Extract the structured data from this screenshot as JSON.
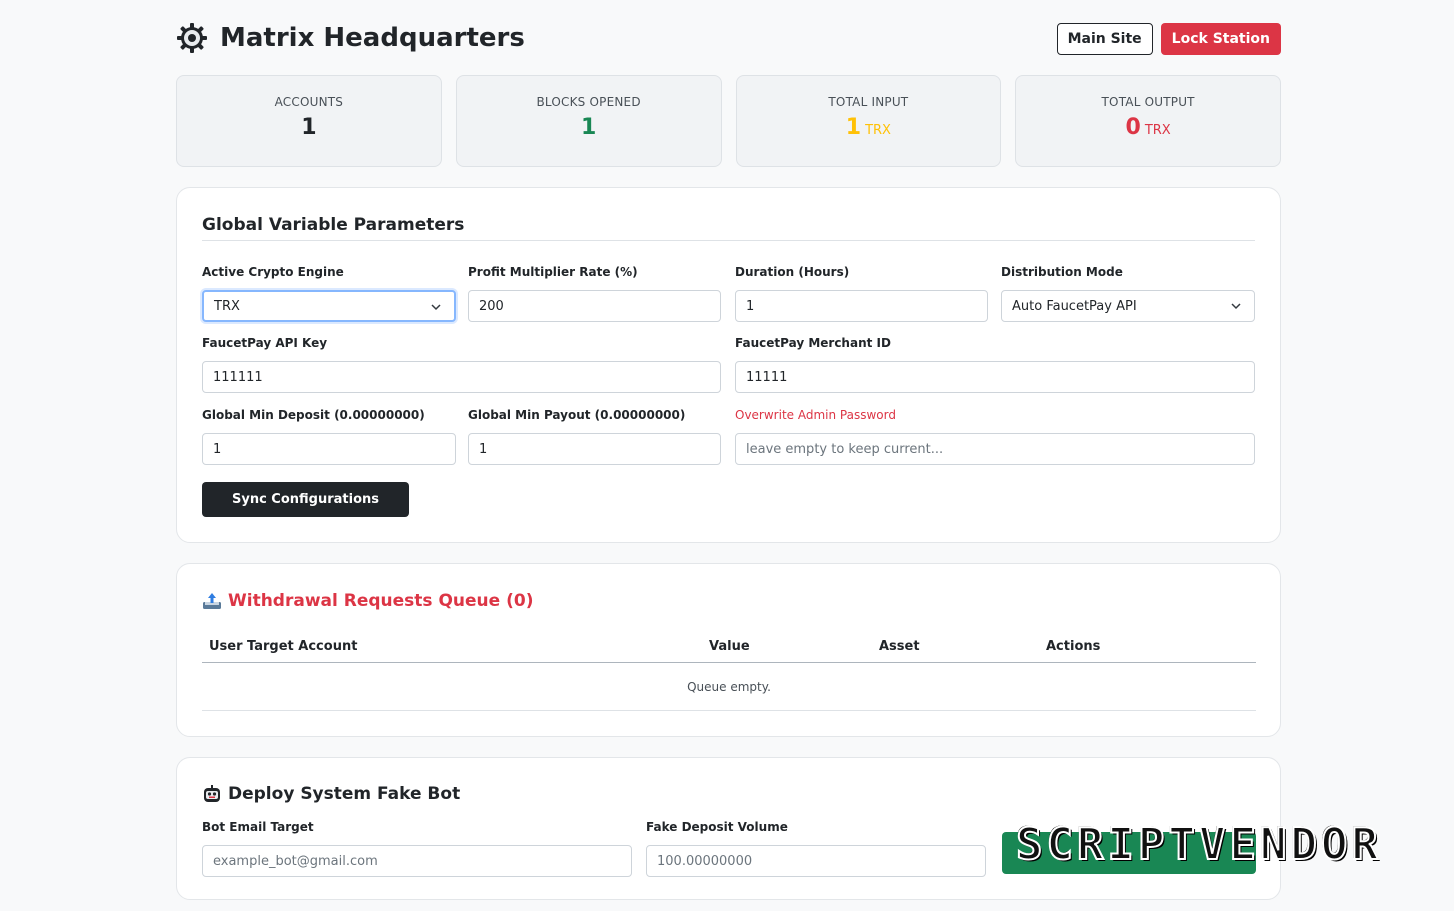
{
  "header": {
    "title": "Matrix Headquarters",
    "main_site_label": "Main Site",
    "lock_station_label": "Lock Station"
  },
  "stats": [
    {
      "label": "ACCOUNTS",
      "value": "1",
      "unit": "",
      "color": "#212529"
    },
    {
      "label": "BLOCKS OPENED",
      "value": "1",
      "unit": "",
      "color": "#198754"
    },
    {
      "label": "TOTAL INPUT",
      "value": "1",
      "unit": "TRX",
      "color": "#ffc107"
    },
    {
      "label": "TOTAL OUTPUT",
      "value": "0",
      "unit": "TRX",
      "color": "#dc3545"
    }
  ],
  "params": {
    "title": "Global Variable Parameters",
    "engine_label": "Active Crypto Engine",
    "engine_value": "TRX",
    "profit_label": "Profit Multiplier Rate (%)",
    "profit_value": "200",
    "duration_label": "Duration (Hours)",
    "duration_value": "1",
    "mode_label": "Distribution Mode",
    "mode_value": "Auto FaucetPay API",
    "api_key_label": "FaucetPay API Key",
    "api_key_value": "111111",
    "merchant_label": "FaucetPay Merchant ID",
    "merchant_value": "11111",
    "min_deposit_label": "Global Min Deposit (0.00000000)",
    "min_deposit_value": "1",
    "min_payout_label": "Global Min Payout (0.00000000)",
    "min_payout_value": "1",
    "password_label": "Overwrite Admin Password",
    "password_placeholder": "leave empty to keep current...",
    "sync_label": "Sync Configurations"
  },
  "withdrawals": {
    "title": "Withdrawal Requests Queue (0)",
    "columns": [
      "User Target Account",
      "Value",
      "Asset",
      "Actions"
    ],
    "empty_text": "Queue empty."
  },
  "bot": {
    "title": "Deploy System Fake Bot",
    "email_label": "Bot Email Target",
    "email_placeholder": "example_bot@gmail.com",
    "volume_label": "Fake Deposit Volume",
    "volume_placeholder": "100.00000000"
  },
  "watermark": {
    "text": "SCRIPTVENDOR"
  },
  "colors": {
    "danger": "#dc3545",
    "success": "#198754",
    "warning": "#ffc107",
    "dark": "#212529"
  }
}
